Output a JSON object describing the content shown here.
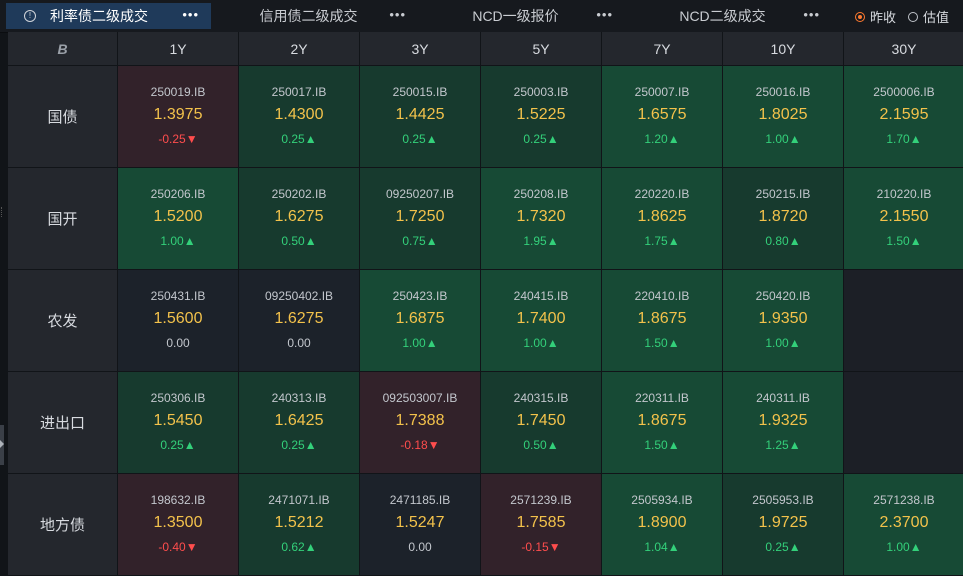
{
  "tabs": [
    {
      "label": "利率债二级成交",
      "active": true
    },
    {
      "label": "信用债二级成交",
      "active": false
    },
    {
      "label": "NCD一级报价",
      "active": false
    },
    {
      "label": "NCD二级成交",
      "active": false
    }
  ],
  "more_glyph": "•••",
  "info_glyph": "!",
  "radio": [
    {
      "label": "昨收",
      "checked": true
    },
    {
      "label": "估值",
      "checked": false
    }
  ],
  "corner_glyph": "B",
  "tenors": [
    "1Y",
    "2Y",
    "3Y",
    "5Y",
    "7Y",
    "10Y",
    "30Y"
  ],
  "colors": {
    "up": "#33d07a",
    "down": "#ff4d4d",
    "rate": "#f3c24b",
    "accent": "#ff7a2f"
  },
  "rows": [
    {
      "name": "国债",
      "cells": [
        {
          "code": "250019.IB",
          "rate": "1.3975",
          "chg": "-0.25▼",
          "dir": "down"
        },
        {
          "code": "250017.IB",
          "rate": "1.4300",
          "chg": "0.25▲",
          "dir": "up"
        },
        {
          "code": "250015.IB",
          "rate": "1.4425",
          "chg": "0.25▲",
          "dir": "up"
        },
        {
          "code": "250003.IB",
          "rate": "1.5225",
          "chg": "0.25▲",
          "dir": "up"
        },
        {
          "code": "250007.IB",
          "rate": "1.6575",
          "chg": "1.20▲",
          "dir": "up"
        },
        {
          "code": "250016.IB",
          "rate": "1.8025",
          "chg": "1.00▲",
          "dir": "up"
        },
        {
          "code": "2500006.IB",
          "rate": "2.1595",
          "chg": "1.70▲",
          "dir": "up"
        }
      ]
    },
    {
      "name": "国开",
      "cells": [
        {
          "code": "250206.IB",
          "rate": "1.5200",
          "chg": "1.00▲",
          "dir": "up"
        },
        {
          "code": "250202.IB",
          "rate": "1.6275",
          "chg": "0.50▲",
          "dir": "up"
        },
        {
          "code": "09250207.IB",
          "rate": "1.7250",
          "chg": "0.75▲",
          "dir": "up"
        },
        {
          "code": "250208.IB",
          "rate": "1.7320",
          "chg": "1.95▲",
          "dir": "up"
        },
        {
          "code": "220220.IB",
          "rate": "1.8625",
          "chg": "1.75▲",
          "dir": "up"
        },
        {
          "code": "250215.IB",
          "rate": "1.8720",
          "chg": "0.80▲",
          "dir": "up"
        },
        {
          "code": "210220.IB",
          "rate": "2.1550",
          "chg": "1.50▲",
          "dir": "up"
        }
      ]
    },
    {
      "name": "农发",
      "cells": [
        {
          "code": "250431.IB",
          "rate": "1.5600",
          "chg": "0.00",
          "dir": "flat"
        },
        {
          "code": "09250402.IB",
          "rate": "1.6275",
          "chg": "0.00",
          "dir": "flat"
        },
        {
          "code": "250423.IB",
          "rate": "1.6875",
          "chg": "1.00▲",
          "dir": "up"
        },
        {
          "code": "240415.IB",
          "rate": "1.7400",
          "chg": "1.00▲",
          "dir": "up"
        },
        {
          "code": "220410.IB",
          "rate": "1.8675",
          "chg": "1.50▲",
          "dir": "up"
        },
        {
          "code": "250420.IB",
          "rate": "1.9350",
          "chg": "1.00▲",
          "dir": "up"
        },
        null
      ]
    },
    {
      "name": "进出口",
      "cells": [
        {
          "code": "250306.IB",
          "rate": "1.5450",
          "chg": "0.25▲",
          "dir": "up"
        },
        {
          "code": "240313.IB",
          "rate": "1.6425",
          "chg": "0.25▲",
          "dir": "up"
        },
        {
          "code": "092503007.IB",
          "rate": "1.7388",
          "chg": "-0.18▼",
          "dir": "down"
        },
        {
          "code": "240315.IB",
          "rate": "1.7450",
          "chg": "0.50▲",
          "dir": "up"
        },
        {
          "code": "220311.IB",
          "rate": "1.8675",
          "chg": "1.50▲",
          "dir": "up"
        },
        {
          "code": "240311.IB",
          "rate": "1.9325",
          "chg": "1.25▲",
          "dir": "up"
        },
        null
      ]
    },
    {
      "name": "地方债",
      "cells": [
        {
          "code": "198632.IB",
          "rate": "1.3500",
          "chg": "-0.40▼",
          "dir": "down"
        },
        {
          "code": "2471071.IB",
          "rate": "1.5212",
          "chg": "0.62▲",
          "dir": "up"
        },
        {
          "code": "2471185.IB",
          "rate": "1.5247",
          "chg": "0.00",
          "dir": "flat"
        },
        {
          "code": "2571239.IB",
          "rate": "1.7585",
          "chg": "-0.15▼",
          "dir": "down"
        },
        {
          "code": "2505934.IB",
          "rate": "1.8900",
          "chg": "1.04▲",
          "dir": "up"
        },
        {
          "code": "2505953.IB",
          "rate": "1.9725",
          "chg": "0.25▲",
          "dir": "up"
        },
        {
          "code": "2571238.IB",
          "rate": "2.3700",
          "chg": "1.00▲",
          "dir": "up"
        }
      ]
    }
  ]
}
